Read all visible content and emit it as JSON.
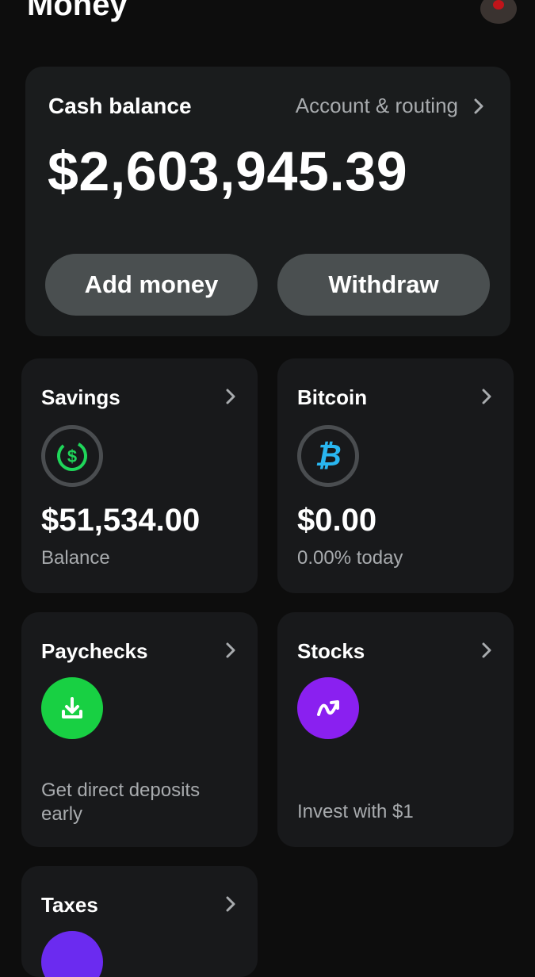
{
  "header": {
    "title": "Money"
  },
  "cash": {
    "label": "Cash balance",
    "account_link": "Account & routing",
    "amount": "$2,603,945.39",
    "add_money": "Add money",
    "withdraw": "Withdraw"
  },
  "tiles": {
    "savings": {
      "title": "Savings",
      "value": "$51,534.00",
      "sub": "Balance",
      "icon": "dollar-circle-icon",
      "color": "#1fd65a"
    },
    "bitcoin": {
      "title": "Bitcoin",
      "value": "$0.00",
      "sub": "0.00% today",
      "icon": "bitcoin-icon",
      "color": "#29b6f0"
    },
    "paychecks": {
      "title": "Paychecks",
      "sub": "Get direct deposits early",
      "icon": "download-icon",
      "color": "#18d043"
    },
    "stocks": {
      "title": "Stocks",
      "sub": "Invest with $1",
      "icon": "stock-trend-icon",
      "color": "#8a20f0"
    },
    "taxes": {
      "title": "Taxes",
      "color": "#6b2bf0"
    }
  }
}
